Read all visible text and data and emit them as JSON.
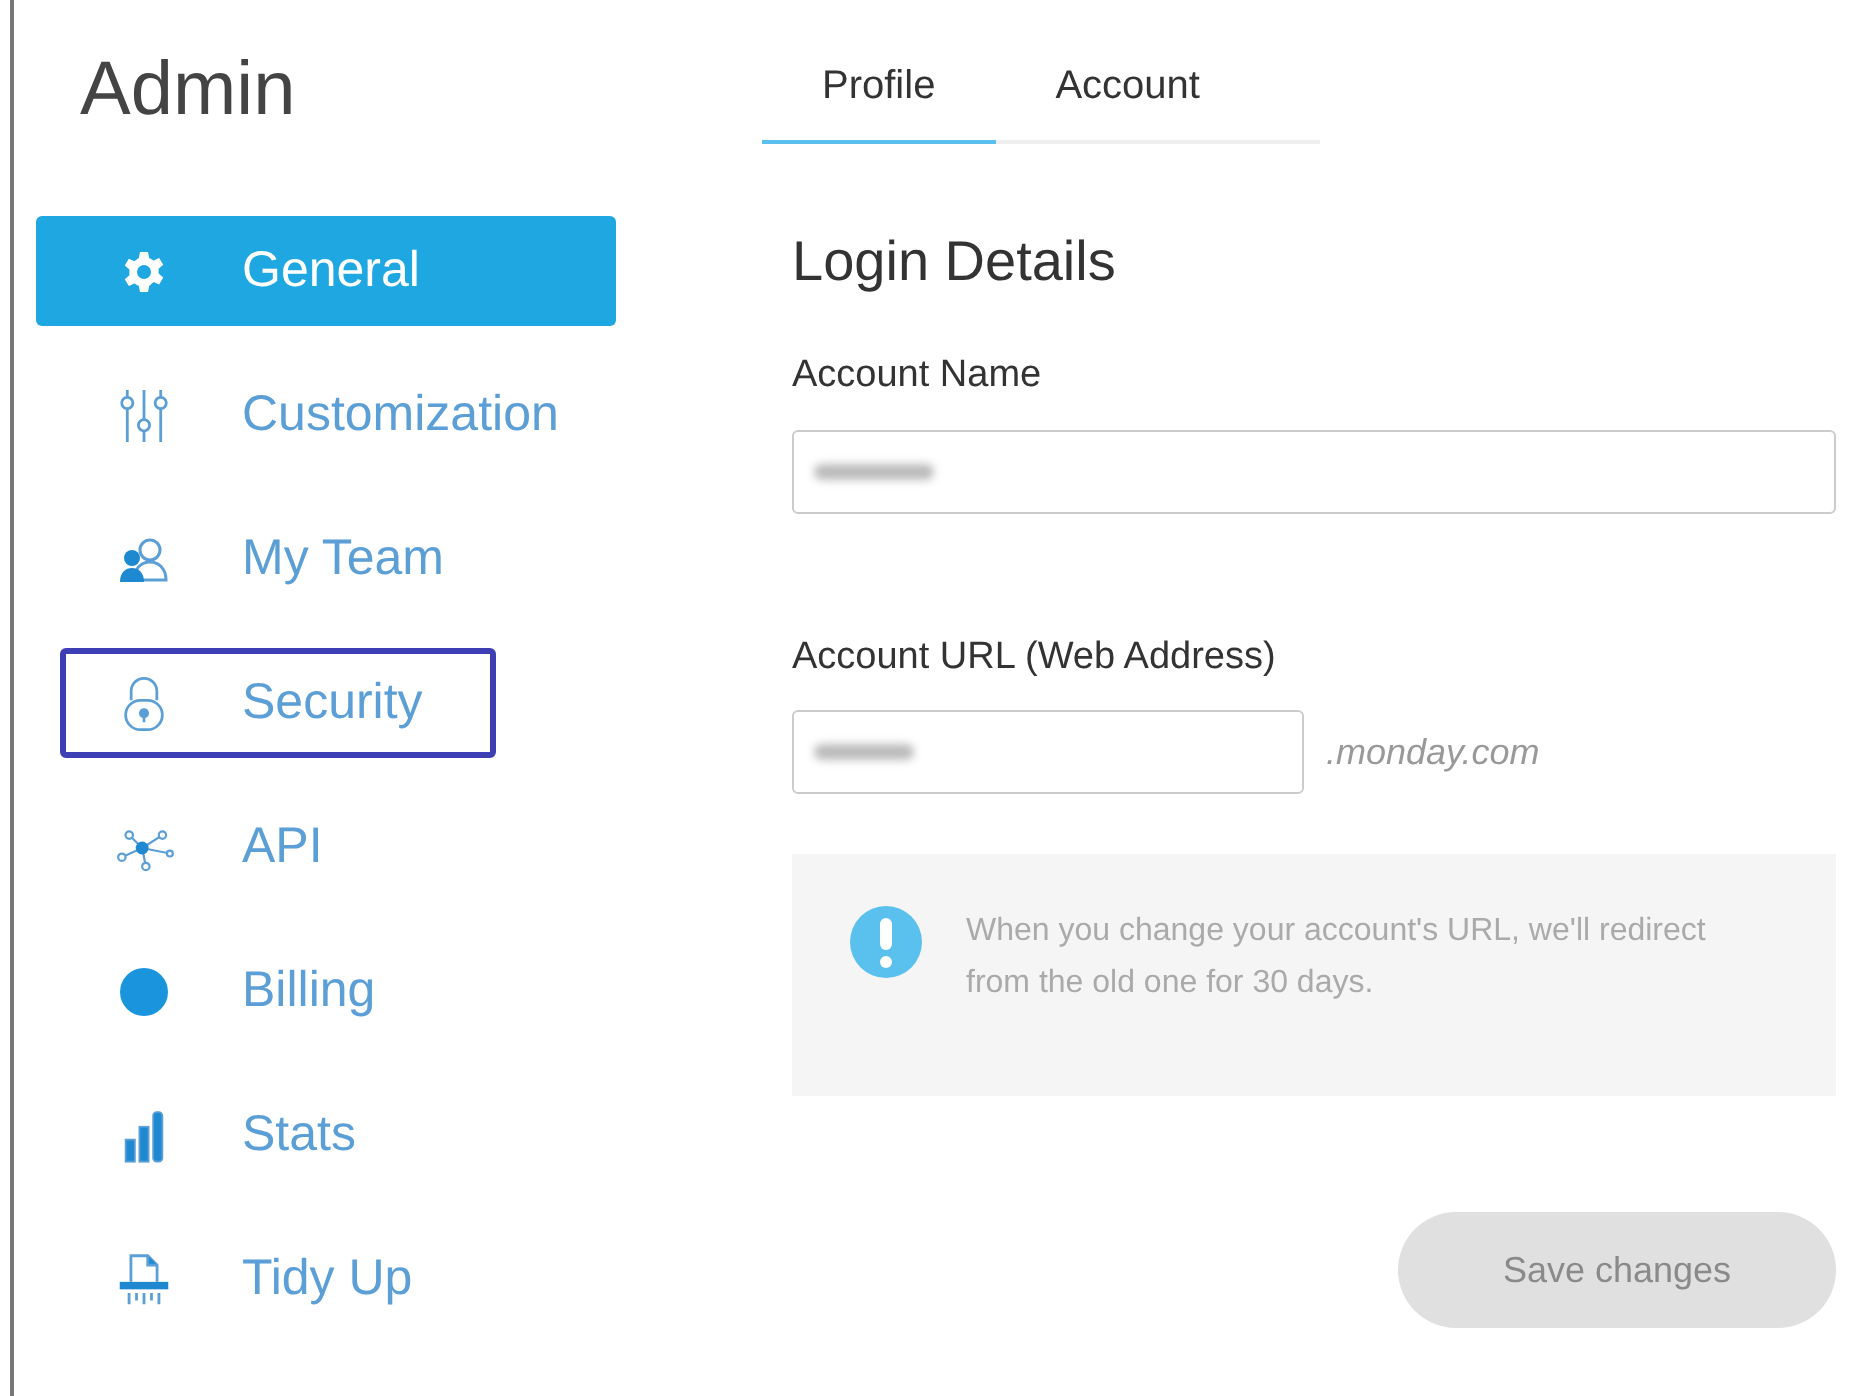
{
  "sidebar": {
    "title": "Admin",
    "items": [
      {
        "label": "General",
        "kind": "gear",
        "selected": true,
        "highlighted": false
      },
      {
        "label": "Customization",
        "kind": "sliders",
        "selected": false,
        "highlighted": false
      },
      {
        "label": "My Team",
        "kind": "team",
        "selected": false,
        "highlighted": false
      },
      {
        "label": "Security",
        "kind": "lock",
        "selected": false,
        "highlighted": true
      },
      {
        "label": "API",
        "kind": "network",
        "selected": false,
        "highlighted": false
      },
      {
        "label": "Billing",
        "kind": "dot",
        "selected": false,
        "highlighted": false
      },
      {
        "label": "Stats",
        "kind": "bars",
        "selected": false,
        "highlighted": false
      },
      {
        "label": "Tidy Up",
        "kind": "shredder",
        "selected": false,
        "highlighted": false
      }
    ]
  },
  "tabs": [
    {
      "label": "Profile",
      "selected": true
    },
    {
      "label": "Account",
      "selected": false
    }
  ],
  "section_title": "Login Details",
  "account_name": {
    "label": "Account Name"
  },
  "account_url": {
    "label": "Account URL (Web Address)",
    "suffix": ".monday.com"
  },
  "notice": "When you change your account's URL, we'll redirect from the old one for 30 days.",
  "save_button": {
    "label": "Save changes",
    "disabled": true
  }
}
